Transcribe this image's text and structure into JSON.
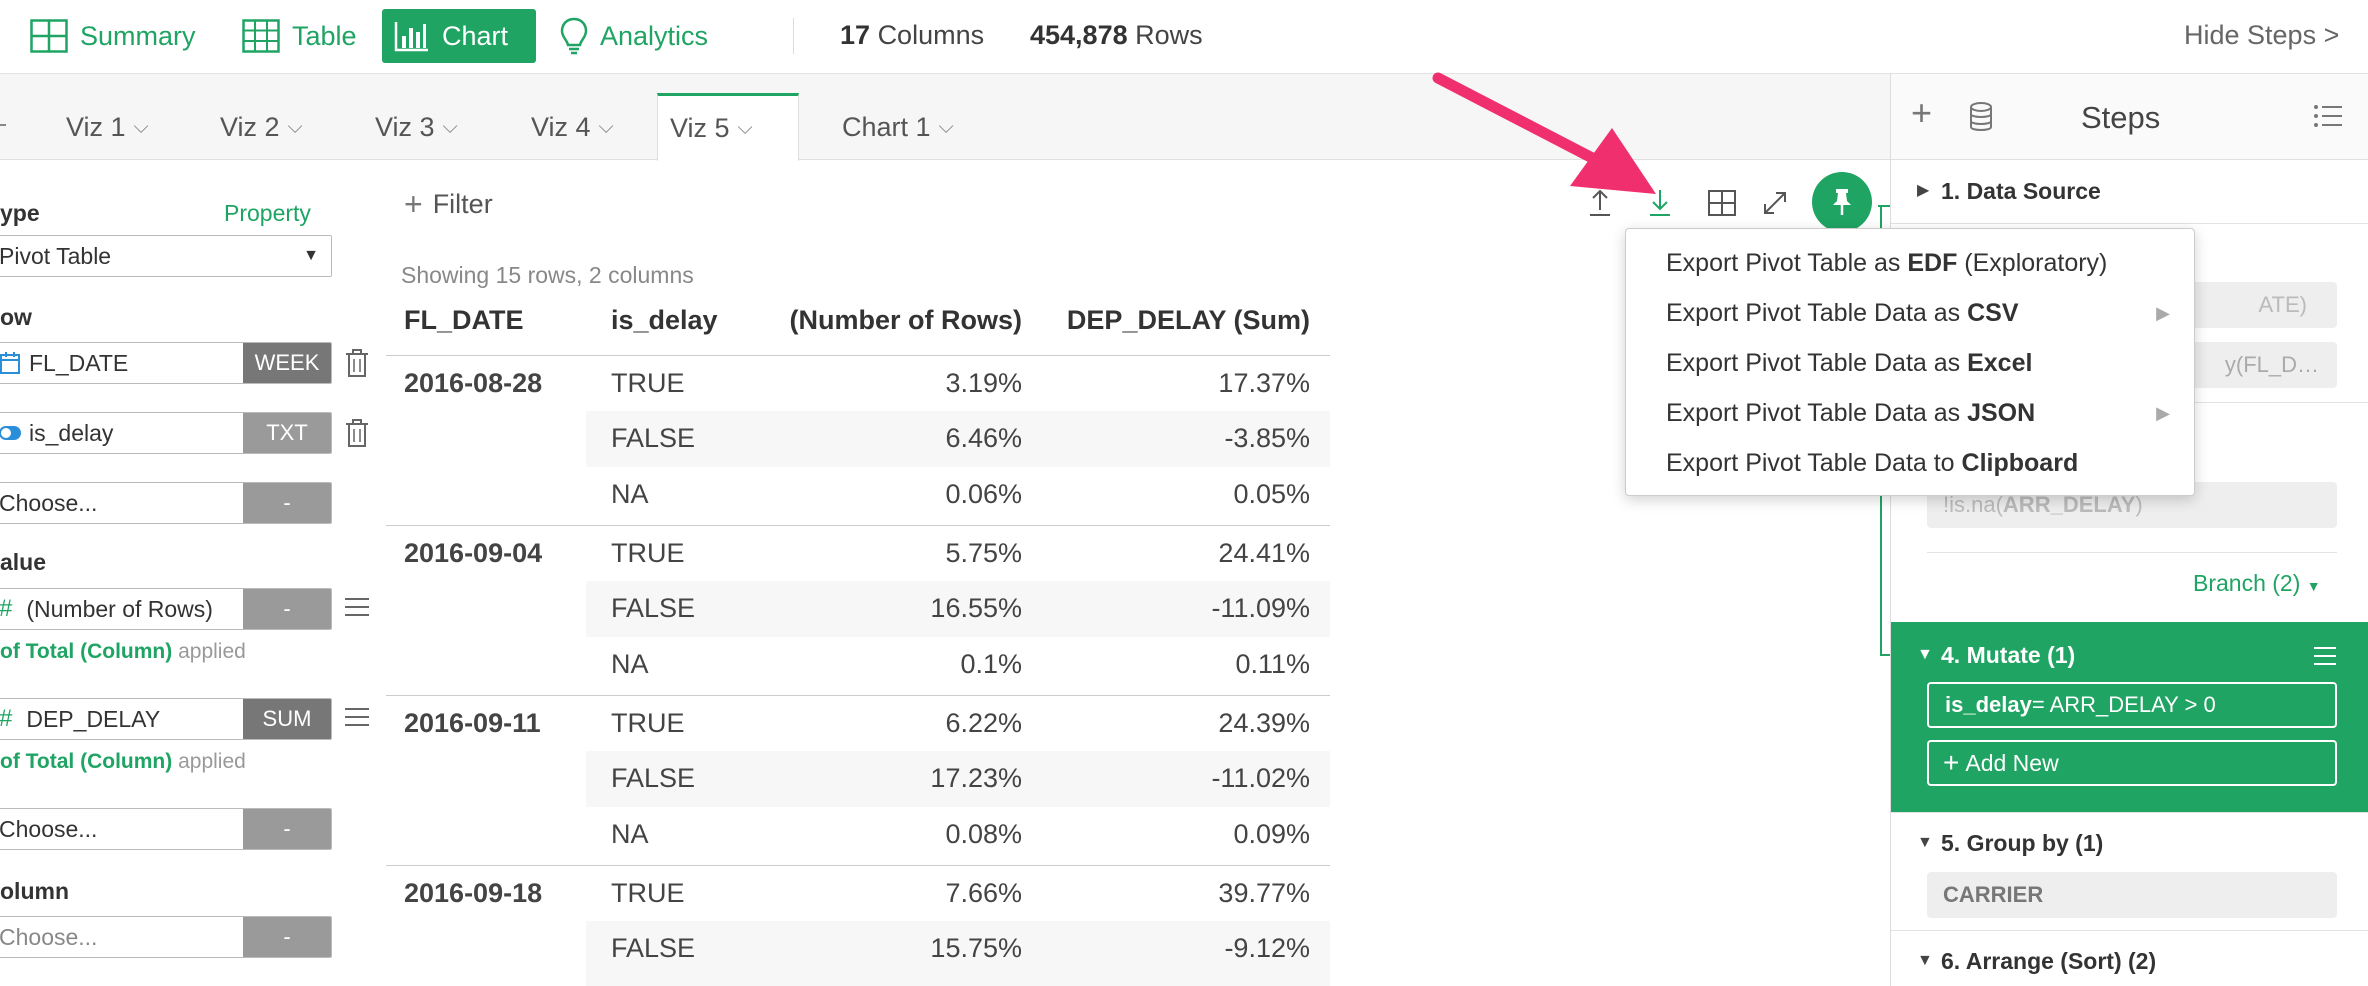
{
  "nav": {
    "summary": "Summary",
    "table": "Table",
    "chart": "Chart",
    "analytics": "Analytics",
    "columns_count": "17",
    "columns_label": "Columns",
    "rows_count": "454,878",
    "rows_label": "Rows",
    "hide_steps": "Hide Steps >"
  },
  "tabs": [
    {
      "label": "Viz 1"
    },
    {
      "label": "Viz 2"
    },
    {
      "label": "Viz 3"
    },
    {
      "label": "Viz 4"
    },
    {
      "label": "Viz 5"
    },
    {
      "label": "Chart 1"
    }
  ],
  "left": {
    "type_label": "ype",
    "property_link": "Property",
    "type_value": "Pivot Table",
    "row_label": "ow",
    "row_fields": [
      {
        "name": "FL_DATE",
        "tag": "WEEK"
      },
      {
        "name": "is_delay",
        "tag": "TXT"
      },
      {
        "name": "Choose...",
        "tag": "-"
      }
    ],
    "value_label": "alue",
    "value_fields": [
      {
        "name": "(Number of Rows)",
        "tag": "-",
        "applied_strong": "of Total (Column)",
        "applied_rest": " applied"
      },
      {
        "name": "DEP_DELAY",
        "tag": "SUM",
        "applied_strong": "of Total (Column)",
        "applied_rest": " applied"
      },
      {
        "name": "Choose...",
        "tag": "-"
      }
    ],
    "column_label": "olumn",
    "column_field": {
      "name": "Choose...",
      "tag": "-"
    }
  },
  "toolbar": {
    "filter_label": "Filter",
    "showing": "Showing 15 rows, 2 columns"
  },
  "table": {
    "headers": [
      "FL_DATE",
      "is_delay",
      "(Number of Rows)",
      "DEP_DELAY (Sum)"
    ],
    "rows": [
      {
        "date": "2016-08-28",
        "delay": "TRUE",
        "n": "3.19%",
        "dep": "17.37%"
      },
      {
        "date": "",
        "delay": "FALSE",
        "n": "6.46%",
        "dep": "-3.85%"
      },
      {
        "date": "",
        "delay": "NA",
        "n": "0.06%",
        "dep": "0.05%"
      },
      {
        "date": "2016-09-04",
        "delay": "TRUE",
        "n": "5.75%",
        "dep": "24.41%"
      },
      {
        "date": "",
        "delay": "FALSE",
        "n": "16.55%",
        "dep": "-11.09%"
      },
      {
        "date": "",
        "delay": "NA",
        "n": "0.1%",
        "dep": "0.11%"
      },
      {
        "date": "2016-09-11",
        "delay": "TRUE",
        "n": "6.22%",
        "dep": "24.39%"
      },
      {
        "date": "",
        "delay": "FALSE",
        "n": "17.23%",
        "dep": "-11.02%"
      },
      {
        "date": "",
        "delay": "NA",
        "n": "0.08%",
        "dep": "0.09%"
      },
      {
        "date": "2016-09-18",
        "delay": "TRUE",
        "n": "7.66%",
        "dep": "39.77%"
      },
      {
        "date": "",
        "delay": "FALSE",
        "n": "15.75%",
        "dep": "-9.12%"
      }
    ]
  },
  "menu": [
    {
      "pre": "Export Pivot Table as ",
      "strong": "EDF",
      "post": " (Exploratory)"
    },
    {
      "pre": "Export Pivot Table Data as ",
      "strong": "CSV",
      "post": ""
    },
    {
      "pre": "Export Pivot Table Data as ",
      "strong": "Excel",
      "post": ""
    },
    {
      "pre": "Export Pivot Table Data as ",
      "strong": "JSON",
      "post": ""
    },
    {
      "pre": "Export Pivot Table Data to ",
      "strong": "Clipboard",
      "post": ""
    }
  ],
  "steps": {
    "title": "Steps",
    "step1": "1. Data Source",
    "hidden_pill_a": "ATE)",
    "hidden_pill_b": "y(FL_D…",
    "filter_expr_pre": "!is.na(",
    "filter_expr_strong": "ARR_DELAY",
    "filter_expr_post": ")",
    "branch": "Branch (2)",
    "step4": "4. Mutate (1)",
    "mutate_strong": "is_delay",
    "mutate_rest": " = ARR_DELAY > 0",
    "add_new": "Add New",
    "step5": "5. Group by (1)",
    "group_value": "CARRIER",
    "step6": "6. Arrange (Sort) (2)"
  },
  "colors": {
    "accent": "#1fa463",
    "arrow": "#f0306e"
  }
}
